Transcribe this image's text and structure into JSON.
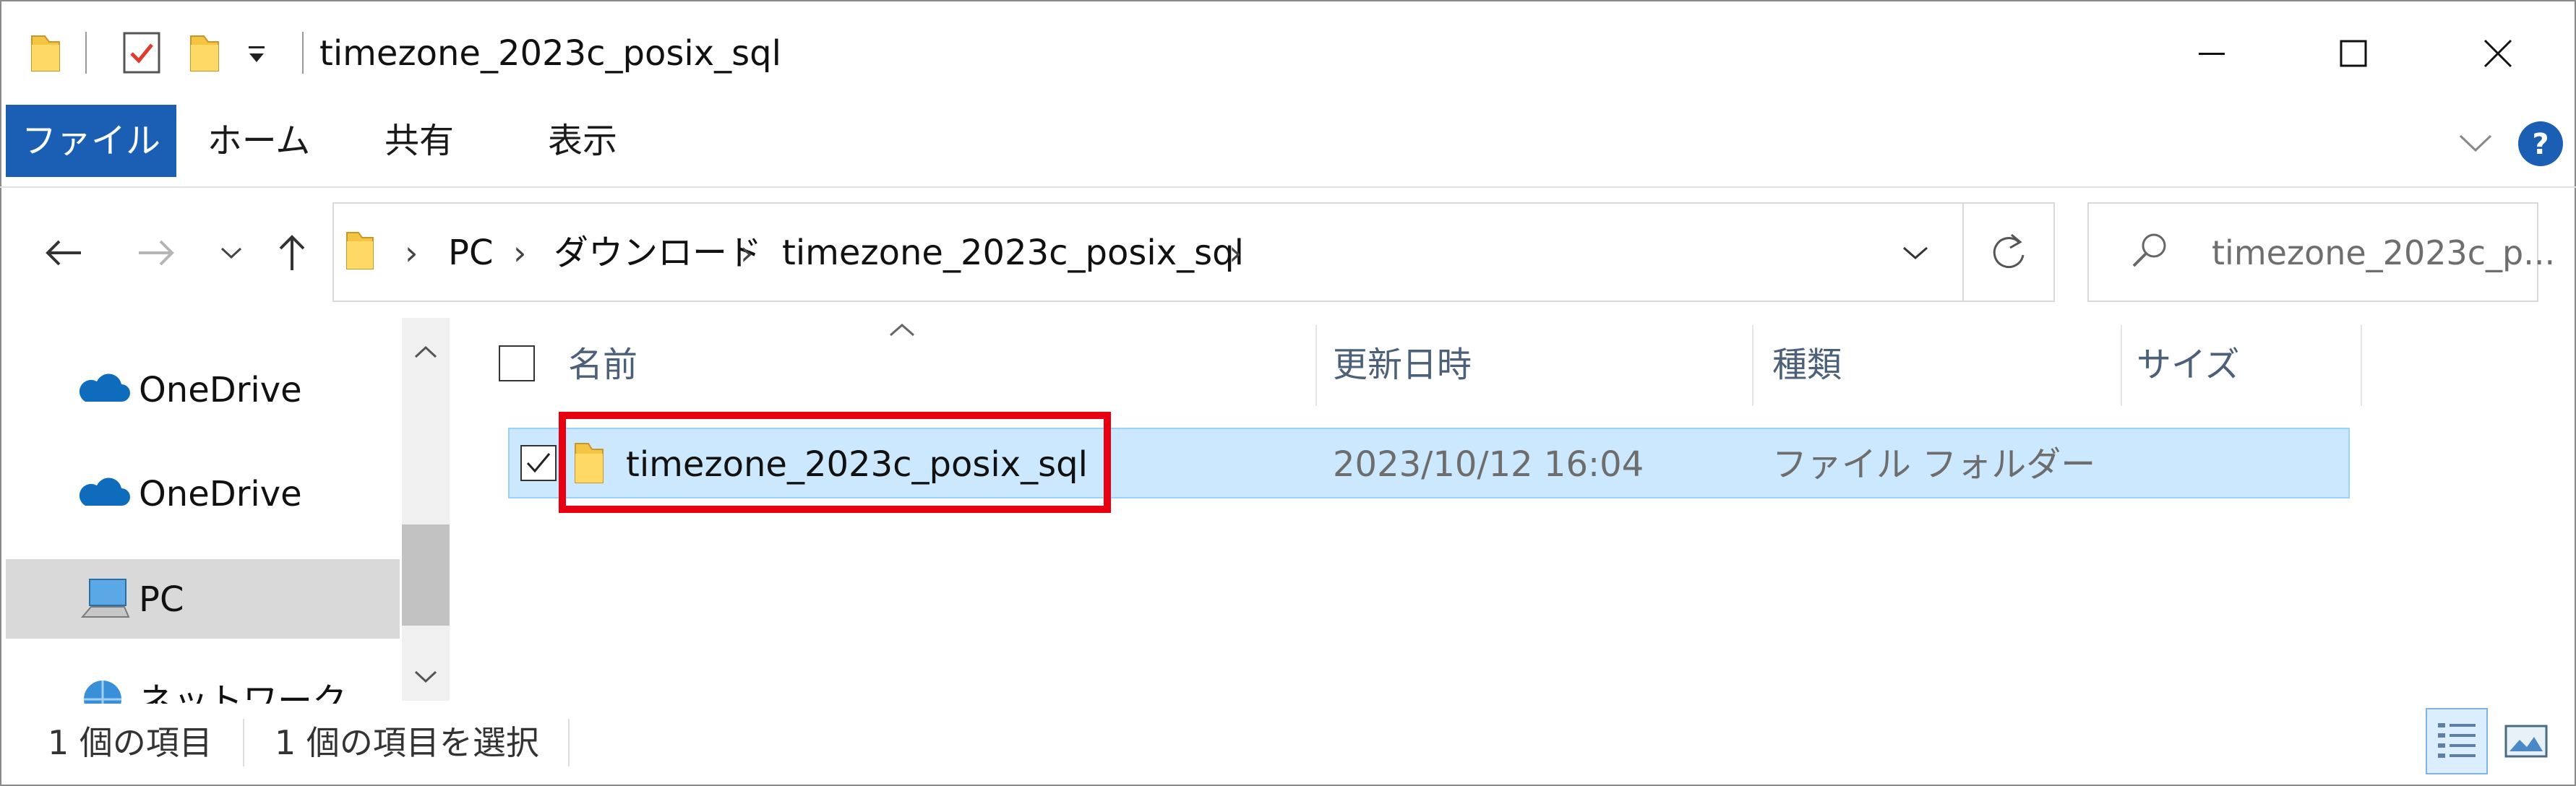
{
  "window": {
    "title": "timezone_2023c_posix_sql"
  },
  "ribbon": {
    "tabs": [
      {
        "label": "ファイル",
        "active": true
      },
      {
        "label": "ホーム"
      },
      {
        "label": "共有"
      },
      {
        "label": "表示"
      }
    ]
  },
  "address": {
    "crumbs": [
      "PC",
      "ダウンロード",
      "timezone_2023c_posix_sql"
    ]
  },
  "search": {
    "placeholder": "timezone_2023c_p..."
  },
  "nav_pane": {
    "items": [
      {
        "label": "OneDrive",
        "icon": "onedrive-icon"
      },
      {
        "label": "OneDrive",
        "icon": "onedrive-icon"
      },
      {
        "label": "PC",
        "icon": "pc-icon",
        "selected": true
      },
      {
        "label": "ネットワーク",
        "icon": "network-icon"
      }
    ]
  },
  "columns": {
    "name": "名前",
    "modified": "更新日時",
    "type": "種類",
    "size": "サイズ"
  },
  "files": [
    {
      "name": "timezone_2023c_posix_sql",
      "modified": "2023/10/12 16:04",
      "type": "ファイル フォルダー",
      "size": "",
      "checked": true,
      "highlighted": true
    }
  ],
  "status": {
    "item_count": "1 個の項目",
    "selected_count": "1 個の項目を選択"
  },
  "colors": {
    "accent": "#1a5fb4",
    "selection": "#cce8ff",
    "highlight_box": "#e60012",
    "folder": "#f4c542"
  }
}
